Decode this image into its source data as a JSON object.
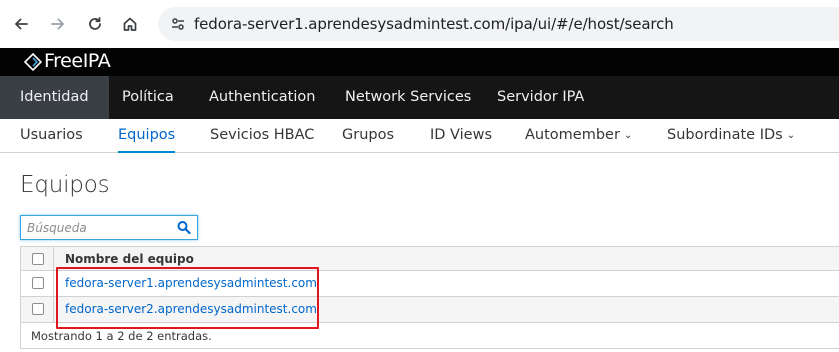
{
  "browser": {
    "url": "fedora-server1.aprendesysadmintest.com/ipa/ui/#/e/host/search"
  },
  "brand": {
    "name": "FreeIPA"
  },
  "primary_nav": {
    "items": [
      {
        "label": "Identidad"
      },
      {
        "label": "Política"
      },
      {
        "label": "Authentication"
      },
      {
        "label": "Network Services"
      },
      {
        "label": "Servidor IPA"
      }
    ]
  },
  "secondary_nav": {
    "items": [
      {
        "label": "Usuarios"
      },
      {
        "label": "Equipos"
      },
      {
        "label": "Sevicios HBAC"
      },
      {
        "label": "Grupos"
      },
      {
        "label": "ID Views"
      },
      {
        "label": "Automember"
      },
      {
        "label": "Subordinate IDs"
      }
    ]
  },
  "page": {
    "title": "Equipos"
  },
  "search": {
    "placeholder": "Búsqueda",
    "value": ""
  },
  "table": {
    "header": "Nombre del equipo",
    "rows": [
      {
        "name": "fedora-server1.aprendesysadmintest.com"
      },
      {
        "name": "fedora-server2.aprendesysadmintest.com"
      }
    ],
    "footer": "Mostrando 1 a 2 de 2 entradas."
  },
  "colors": {
    "accent": "#0066cc",
    "highlight": "#e0161e",
    "masthead": "#030303",
    "primary_nav": "#151515",
    "primary_active": "#393f44"
  }
}
